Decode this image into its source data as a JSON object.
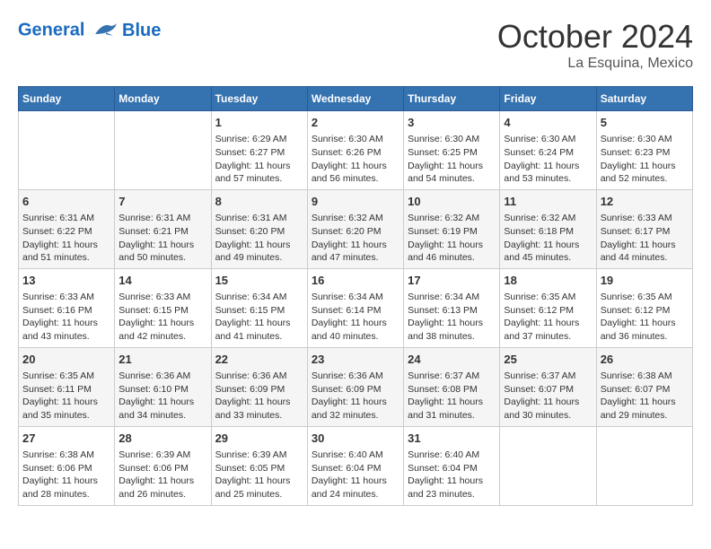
{
  "header": {
    "logo_line1": "General",
    "logo_line2": "Blue",
    "title": "October 2024",
    "subtitle": "La Esquina, Mexico"
  },
  "columns": [
    "Sunday",
    "Monday",
    "Tuesday",
    "Wednesday",
    "Thursday",
    "Friday",
    "Saturday"
  ],
  "weeks": [
    [
      {
        "day": "",
        "sunrise": "",
        "sunset": "",
        "daylight": ""
      },
      {
        "day": "",
        "sunrise": "",
        "sunset": "",
        "daylight": ""
      },
      {
        "day": "1",
        "sunrise": "Sunrise: 6:29 AM",
        "sunset": "Sunset: 6:27 PM",
        "daylight": "Daylight: 11 hours and 57 minutes."
      },
      {
        "day": "2",
        "sunrise": "Sunrise: 6:30 AM",
        "sunset": "Sunset: 6:26 PM",
        "daylight": "Daylight: 11 hours and 56 minutes."
      },
      {
        "day": "3",
        "sunrise": "Sunrise: 6:30 AM",
        "sunset": "Sunset: 6:25 PM",
        "daylight": "Daylight: 11 hours and 54 minutes."
      },
      {
        "day": "4",
        "sunrise": "Sunrise: 6:30 AM",
        "sunset": "Sunset: 6:24 PM",
        "daylight": "Daylight: 11 hours and 53 minutes."
      },
      {
        "day": "5",
        "sunrise": "Sunrise: 6:30 AM",
        "sunset": "Sunset: 6:23 PM",
        "daylight": "Daylight: 11 hours and 52 minutes."
      }
    ],
    [
      {
        "day": "6",
        "sunrise": "Sunrise: 6:31 AM",
        "sunset": "Sunset: 6:22 PM",
        "daylight": "Daylight: 11 hours and 51 minutes."
      },
      {
        "day": "7",
        "sunrise": "Sunrise: 6:31 AM",
        "sunset": "Sunset: 6:21 PM",
        "daylight": "Daylight: 11 hours and 50 minutes."
      },
      {
        "day": "8",
        "sunrise": "Sunrise: 6:31 AM",
        "sunset": "Sunset: 6:20 PM",
        "daylight": "Daylight: 11 hours and 49 minutes."
      },
      {
        "day": "9",
        "sunrise": "Sunrise: 6:32 AM",
        "sunset": "Sunset: 6:20 PM",
        "daylight": "Daylight: 11 hours and 47 minutes."
      },
      {
        "day": "10",
        "sunrise": "Sunrise: 6:32 AM",
        "sunset": "Sunset: 6:19 PM",
        "daylight": "Daylight: 11 hours and 46 minutes."
      },
      {
        "day": "11",
        "sunrise": "Sunrise: 6:32 AM",
        "sunset": "Sunset: 6:18 PM",
        "daylight": "Daylight: 11 hours and 45 minutes."
      },
      {
        "day": "12",
        "sunrise": "Sunrise: 6:33 AM",
        "sunset": "Sunset: 6:17 PM",
        "daylight": "Daylight: 11 hours and 44 minutes."
      }
    ],
    [
      {
        "day": "13",
        "sunrise": "Sunrise: 6:33 AM",
        "sunset": "Sunset: 6:16 PM",
        "daylight": "Daylight: 11 hours and 43 minutes."
      },
      {
        "day": "14",
        "sunrise": "Sunrise: 6:33 AM",
        "sunset": "Sunset: 6:15 PM",
        "daylight": "Daylight: 11 hours and 42 minutes."
      },
      {
        "day": "15",
        "sunrise": "Sunrise: 6:34 AM",
        "sunset": "Sunset: 6:15 PM",
        "daylight": "Daylight: 11 hours and 41 minutes."
      },
      {
        "day": "16",
        "sunrise": "Sunrise: 6:34 AM",
        "sunset": "Sunset: 6:14 PM",
        "daylight": "Daylight: 11 hours and 40 minutes."
      },
      {
        "day": "17",
        "sunrise": "Sunrise: 6:34 AM",
        "sunset": "Sunset: 6:13 PM",
        "daylight": "Daylight: 11 hours and 38 minutes."
      },
      {
        "day": "18",
        "sunrise": "Sunrise: 6:35 AM",
        "sunset": "Sunset: 6:12 PM",
        "daylight": "Daylight: 11 hours and 37 minutes."
      },
      {
        "day": "19",
        "sunrise": "Sunrise: 6:35 AM",
        "sunset": "Sunset: 6:12 PM",
        "daylight": "Daylight: 11 hours and 36 minutes."
      }
    ],
    [
      {
        "day": "20",
        "sunrise": "Sunrise: 6:35 AM",
        "sunset": "Sunset: 6:11 PM",
        "daylight": "Daylight: 11 hours and 35 minutes."
      },
      {
        "day": "21",
        "sunrise": "Sunrise: 6:36 AM",
        "sunset": "Sunset: 6:10 PM",
        "daylight": "Daylight: 11 hours and 34 minutes."
      },
      {
        "day": "22",
        "sunrise": "Sunrise: 6:36 AM",
        "sunset": "Sunset: 6:09 PM",
        "daylight": "Daylight: 11 hours and 33 minutes."
      },
      {
        "day": "23",
        "sunrise": "Sunrise: 6:36 AM",
        "sunset": "Sunset: 6:09 PM",
        "daylight": "Daylight: 11 hours and 32 minutes."
      },
      {
        "day": "24",
        "sunrise": "Sunrise: 6:37 AM",
        "sunset": "Sunset: 6:08 PM",
        "daylight": "Daylight: 11 hours and 31 minutes."
      },
      {
        "day": "25",
        "sunrise": "Sunrise: 6:37 AM",
        "sunset": "Sunset: 6:07 PM",
        "daylight": "Daylight: 11 hours and 30 minutes."
      },
      {
        "day": "26",
        "sunrise": "Sunrise: 6:38 AM",
        "sunset": "Sunset: 6:07 PM",
        "daylight": "Daylight: 11 hours and 29 minutes."
      }
    ],
    [
      {
        "day": "27",
        "sunrise": "Sunrise: 6:38 AM",
        "sunset": "Sunset: 6:06 PM",
        "daylight": "Daylight: 11 hours and 28 minutes."
      },
      {
        "day": "28",
        "sunrise": "Sunrise: 6:39 AM",
        "sunset": "Sunset: 6:06 PM",
        "daylight": "Daylight: 11 hours and 26 minutes."
      },
      {
        "day": "29",
        "sunrise": "Sunrise: 6:39 AM",
        "sunset": "Sunset: 6:05 PM",
        "daylight": "Daylight: 11 hours and 25 minutes."
      },
      {
        "day": "30",
        "sunrise": "Sunrise: 6:40 AM",
        "sunset": "Sunset: 6:04 PM",
        "daylight": "Daylight: 11 hours and 24 minutes."
      },
      {
        "day": "31",
        "sunrise": "Sunrise: 6:40 AM",
        "sunset": "Sunset: 6:04 PM",
        "daylight": "Daylight: 11 hours and 23 minutes."
      },
      {
        "day": "",
        "sunrise": "",
        "sunset": "",
        "daylight": ""
      },
      {
        "day": "",
        "sunrise": "",
        "sunset": "",
        "daylight": ""
      }
    ]
  ]
}
